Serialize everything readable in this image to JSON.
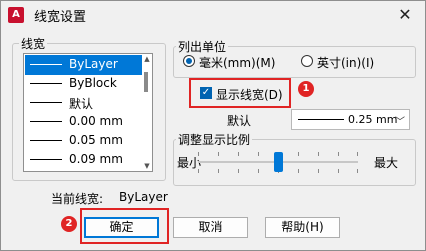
{
  "window": {
    "title": "线宽设置",
    "app_icon_text": "A",
    "close_glyph": "✕"
  },
  "lineweights": {
    "label": "线宽",
    "items": [
      {
        "label": "ByLayer",
        "selected": true
      },
      {
        "label": "ByBlock",
        "selected": false
      },
      {
        "label": "默认",
        "selected": false
      },
      {
        "label": "0.00 mm",
        "selected": false
      },
      {
        "label": "0.05 mm",
        "selected": false
      },
      {
        "label": "0.09 mm",
        "selected": false
      }
    ]
  },
  "units": {
    "label": "列出单位",
    "mm": {
      "label": "毫米(mm)(M)",
      "checked": true
    },
    "inch": {
      "label": "英寸(in)(I)",
      "checked": false
    }
  },
  "display": {
    "label": "显示线宽(D)",
    "checked": true,
    "check_glyph": "✓",
    "callout": "1"
  },
  "default": {
    "label": "默认",
    "value": "0.25 mm",
    "arrow": "﹀"
  },
  "scale": {
    "label": "调整显示比例",
    "min_label": "最小",
    "max_label": "最大",
    "level": 0.5
  },
  "current": {
    "label": "当前线宽:",
    "value": "ByLayer"
  },
  "buttons": {
    "ok": "确定",
    "cancel": "取消",
    "help": "帮助(H)",
    "callout": "2"
  },
  "colors": {
    "accent": "#0078d7",
    "highlight": "#e02424"
  }
}
